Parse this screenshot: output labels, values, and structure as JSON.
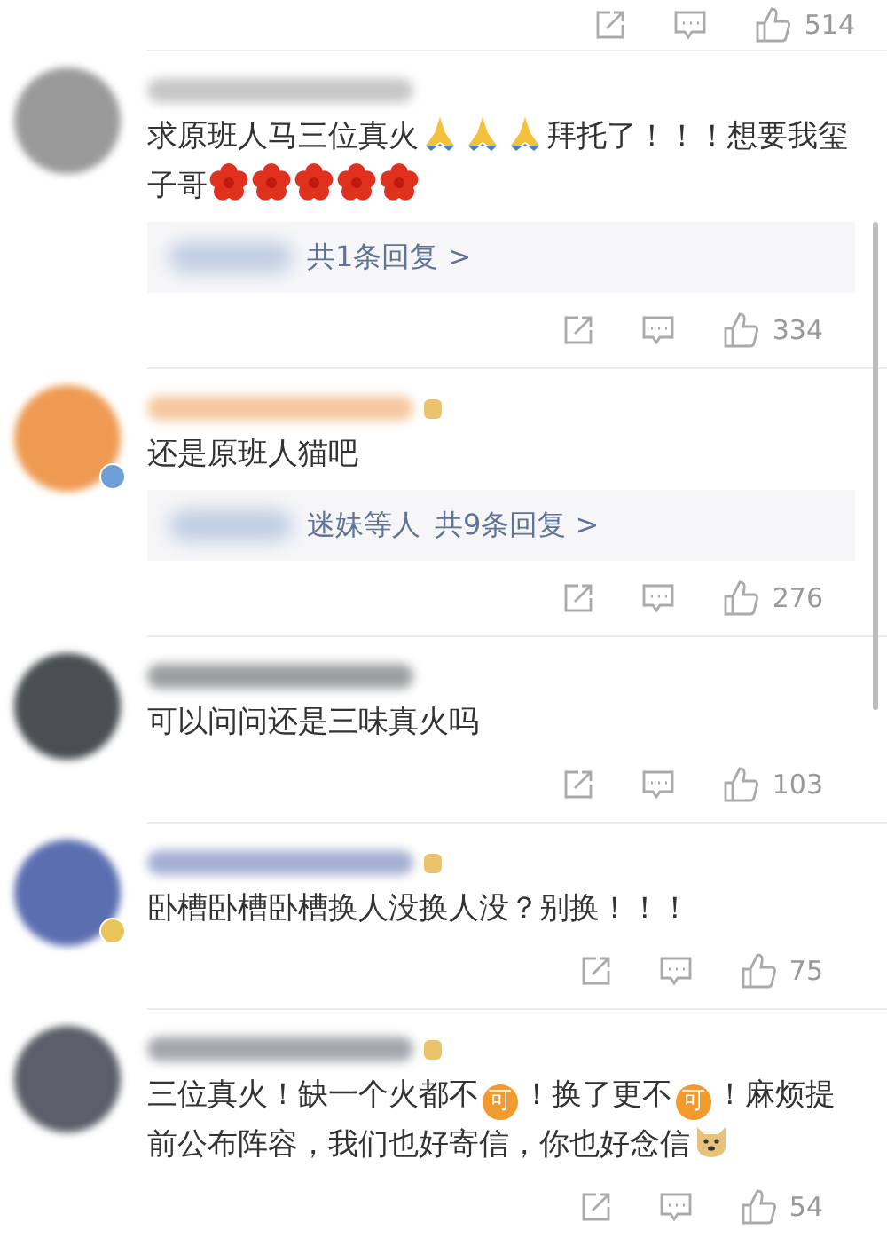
{
  "top_actions": {
    "likes": "514"
  },
  "comments": [
    {
      "avatar": {
        "color": "#9a9a9a"
      },
      "name_badge": false,
      "body": [
        {
          "kind": "text",
          "text": "求原班人马三位真火"
        },
        {
          "kind": "pray"
        },
        {
          "kind": "pray"
        },
        {
          "kind": "pray"
        },
        {
          "kind": "text",
          "text": "拜托了！！！想要我玺子哥"
        },
        {
          "kind": "flower"
        },
        {
          "kind": "flower"
        },
        {
          "kind": "flower"
        },
        {
          "kind": "flower"
        },
        {
          "kind": "flower"
        }
      ],
      "replies": [
        {
          "text": "共1条回复 >"
        }
      ],
      "likes": "334"
    },
    {
      "avatar": {
        "color": "#ee9a52",
        "badge": {
          "color": "#6d9fd6"
        }
      },
      "name_badge": true,
      "body": [
        {
          "kind": "text",
          "text": "还是原班人猫吧"
        }
      ],
      "replies": [
        {
          "text": "迷妹等人"
        },
        {
          "text": "共9条回复 >"
        }
      ],
      "likes": "276"
    },
    {
      "avatar": {
        "color": "#4a4f52"
      },
      "name_badge": false,
      "body": [
        {
          "kind": "text",
          "text": "可以问问还是三味真火吗"
        }
      ],
      "likes": "103"
    },
    {
      "avatar": {
        "color": "#5b6fb0",
        "badge": {
          "color": "#e9c45a"
        }
      },
      "name_badge": true,
      "body": [
        {
          "kind": "text",
          "text": "卧槽卧槽卧槽换人没换人没？别换！！！"
        }
      ],
      "likes": "75"
    },
    {
      "avatar": {
        "color": "#5c5f6a"
      },
      "name_badge": true,
      "body": [
        {
          "kind": "text",
          "text": "三位真火！缺一个火都不"
        },
        {
          "kind": "badge",
          "text": "可"
        },
        {
          "kind": "text",
          "text": "！换了更不"
        },
        {
          "kind": "badge",
          "text": "可"
        },
        {
          "kind": "text",
          "text": "！麻烦提前公布阵容，我们也好寄信，你也好念信"
        },
        {
          "kind": "doge"
        }
      ],
      "likes": "54"
    }
  ]
}
